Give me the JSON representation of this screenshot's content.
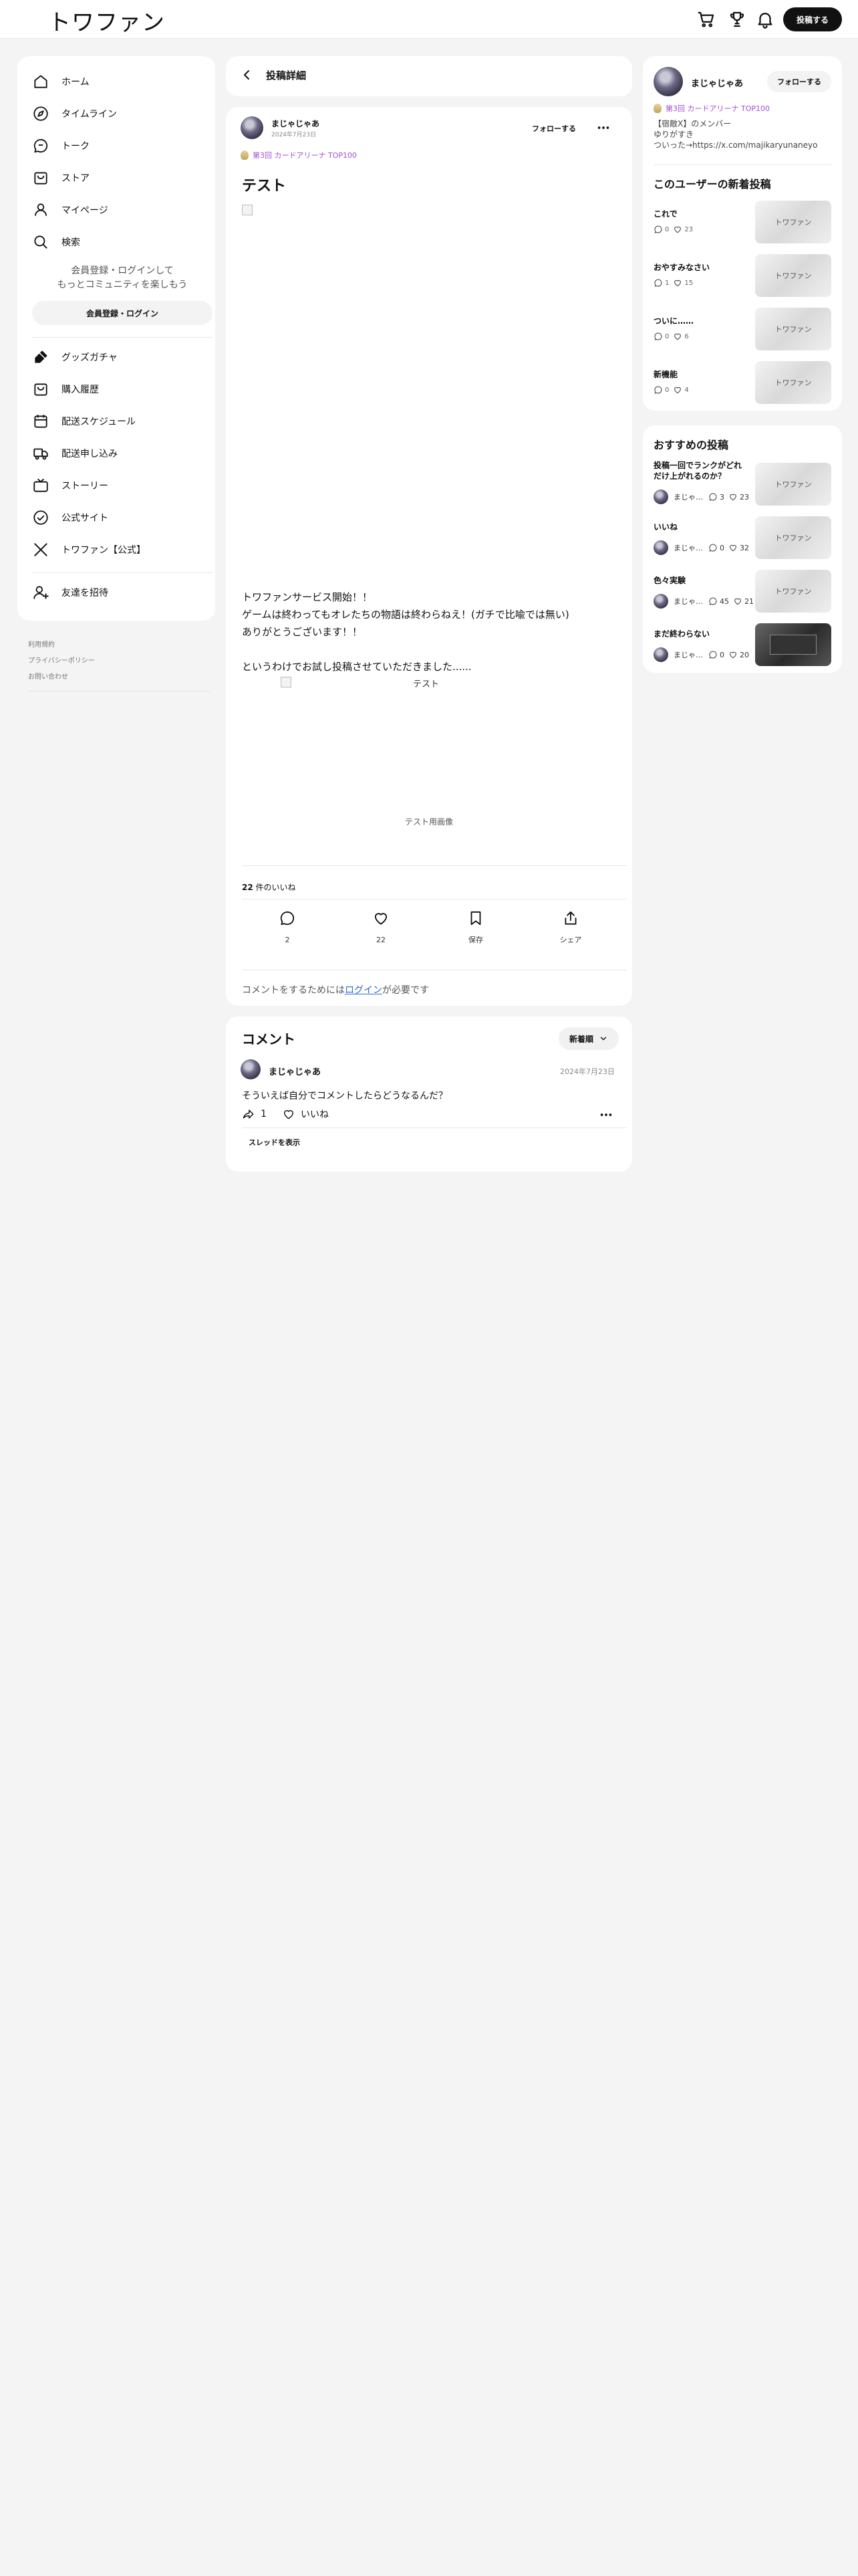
{
  "header": {
    "logo": "トワファン",
    "post_button": "投稿する",
    "icons": [
      "cart-icon",
      "trophy-icon",
      "bell-icon"
    ]
  },
  "sidebar": {
    "items": [
      {
        "label": "ホーム",
        "icon": "home-icon"
      },
      {
        "label": "タイムライン",
        "icon": "compass-icon"
      },
      {
        "label": "トーク",
        "icon": "chat-icon"
      },
      {
        "label": "ストア",
        "icon": "store-icon"
      },
      {
        "label": "マイページ",
        "icon": "user-icon"
      },
      {
        "label": "検索",
        "icon": "search-icon"
      }
    ],
    "promo_line1": "会員登録・ログインして",
    "promo_line2": "もっとコミュニティを楽しもう",
    "register_button": "会員登録・ログイン",
    "items2": [
      {
        "label": "グッズガチャ",
        "icon": "gacha-icon"
      },
      {
        "label": "購入履歴",
        "icon": "bag-icon"
      },
      {
        "label": "配送スケジュール",
        "icon": "calendar-icon"
      },
      {
        "label": "配送申し込み",
        "icon": "truck-icon"
      },
      {
        "label": "ストーリー",
        "icon": "tv-icon"
      },
      {
        "label": "公式サイト",
        "icon": "check-circle-icon"
      },
      {
        "label": "トワファン【公式】",
        "icon": "x-logo-icon"
      }
    ],
    "invite": {
      "label": "友達を招待",
      "icon": "user-plus-icon"
    },
    "footer_links": [
      "利用規約",
      "プライバシーポリシー",
      "お問い合わせ"
    ]
  },
  "post": {
    "header_title": "投稿詳細",
    "author": "まじゃじゃあ",
    "date": "2024年7月23日",
    "follow": "フォローする",
    "badge": "第3回 カードアリーナ TOP100",
    "title": "テスト",
    "body": [
      "トワファンサービス開始！！",
      "ゲームは終わってもオレたちの物語は終わらねえ！(ガチで比喩では無い)",
      "ありがとうございます！！",
      "",
      "というわけでお試し投稿させていただきました......"
    ],
    "image_alt": "テスト",
    "image_caption": "テスト用画像",
    "likes_count": "22",
    "likes_suffix": "件のいいね",
    "actions": [
      {
        "label": "2",
        "icon": "comment-icon"
      },
      {
        "label": "22",
        "icon": "heart-icon"
      },
      {
        "label": "保存",
        "icon": "bookmark-icon"
      },
      {
        "label": "シェア",
        "icon": "share-icon"
      }
    ],
    "login_note_prefix": "コメントをするためには",
    "login_note_link": "ログイン",
    "login_note_suffix": "が必要です"
  },
  "comments": {
    "title": "コメント",
    "sort": "新着順",
    "items": [
      {
        "author": "まじゃじゃあ",
        "date": "2024年7月23日",
        "text": "そういえば自分でコメントしたらどうなるんだ？",
        "reply_count": "1",
        "like_label": "いいね",
        "thread": "スレッドを表示"
      }
    ]
  },
  "right": {
    "profile": {
      "name": "まじゃじゃあ",
      "follow": "フォローする",
      "badge": "第3回 カードアリーナ TOP100",
      "bio": [
        "【宿敵X】のメンバー",
        "ゆりがすき",
        "ついった→https://x.com/majikaryunaneyo"
      ]
    },
    "new_posts_title": "このユーザーの新着投稿",
    "new_posts": [
      {
        "title": "これで",
        "comments": "0",
        "likes": "23",
        "thumb": "トワファン"
      },
      {
        "title": "おやすみなさい",
        "comments": "1",
        "likes": "15",
        "thumb": "トワファン"
      },
      {
        "title": "ついに……",
        "comments": "0",
        "likes": "6",
        "thumb": "トワファン"
      },
      {
        "title": "新機能",
        "comments": "0",
        "likes": "4",
        "thumb": "トワファン"
      }
    ],
    "rec_title": "おすすめの投稿",
    "rec_posts": [
      {
        "title": "投稿一回でランクがどれだけ上がれるのか？",
        "author": "まじゃ…",
        "comments": "3",
        "likes": "23",
        "thumb": "トワファン"
      },
      {
        "title": "いいね",
        "author": "まじゃ…",
        "comments": "0",
        "likes": "32",
        "thumb": "トワファン"
      },
      {
        "title": "色々実験",
        "author": "まじゃ…",
        "comments": "45",
        "likes": "21",
        "thumb": "トワファン"
      },
      {
        "title": "まだ終わらない",
        "author": "まじゃ…",
        "comments": "0",
        "likes": "20",
        "thumb": ""
      }
    ]
  }
}
